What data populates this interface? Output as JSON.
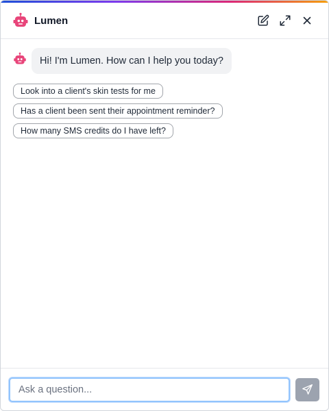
{
  "header": {
    "title": "Lumen",
    "actions": [
      "new-chat",
      "expand",
      "close"
    ]
  },
  "conversation": {
    "messages": [
      {
        "sender": "bot",
        "text": "Hi! I'm Lumen. How can I help you today?"
      }
    ],
    "suggestions": [
      "Look into a client's skin tests for me",
      "Has a client been sent their appointment reminder?",
      "How many SMS credits do I have left?"
    ]
  },
  "composer": {
    "placeholder": "Ask a question...",
    "value": ""
  },
  "colors": {
    "accent_gradient": [
      "#1d4ed8",
      "#7c3aed",
      "#db2777",
      "#f59e0b"
    ],
    "bot_icon": "#e8457a",
    "send_button": "#9ca3af",
    "input_focus": "#93c5fd"
  },
  "icons": {
    "bot": "robot-icon",
    "new_chat": "edit-icon",
    "expand": "expand-icon",
    "close": "close-icon",
    "send": "send-icon"
  }
}
